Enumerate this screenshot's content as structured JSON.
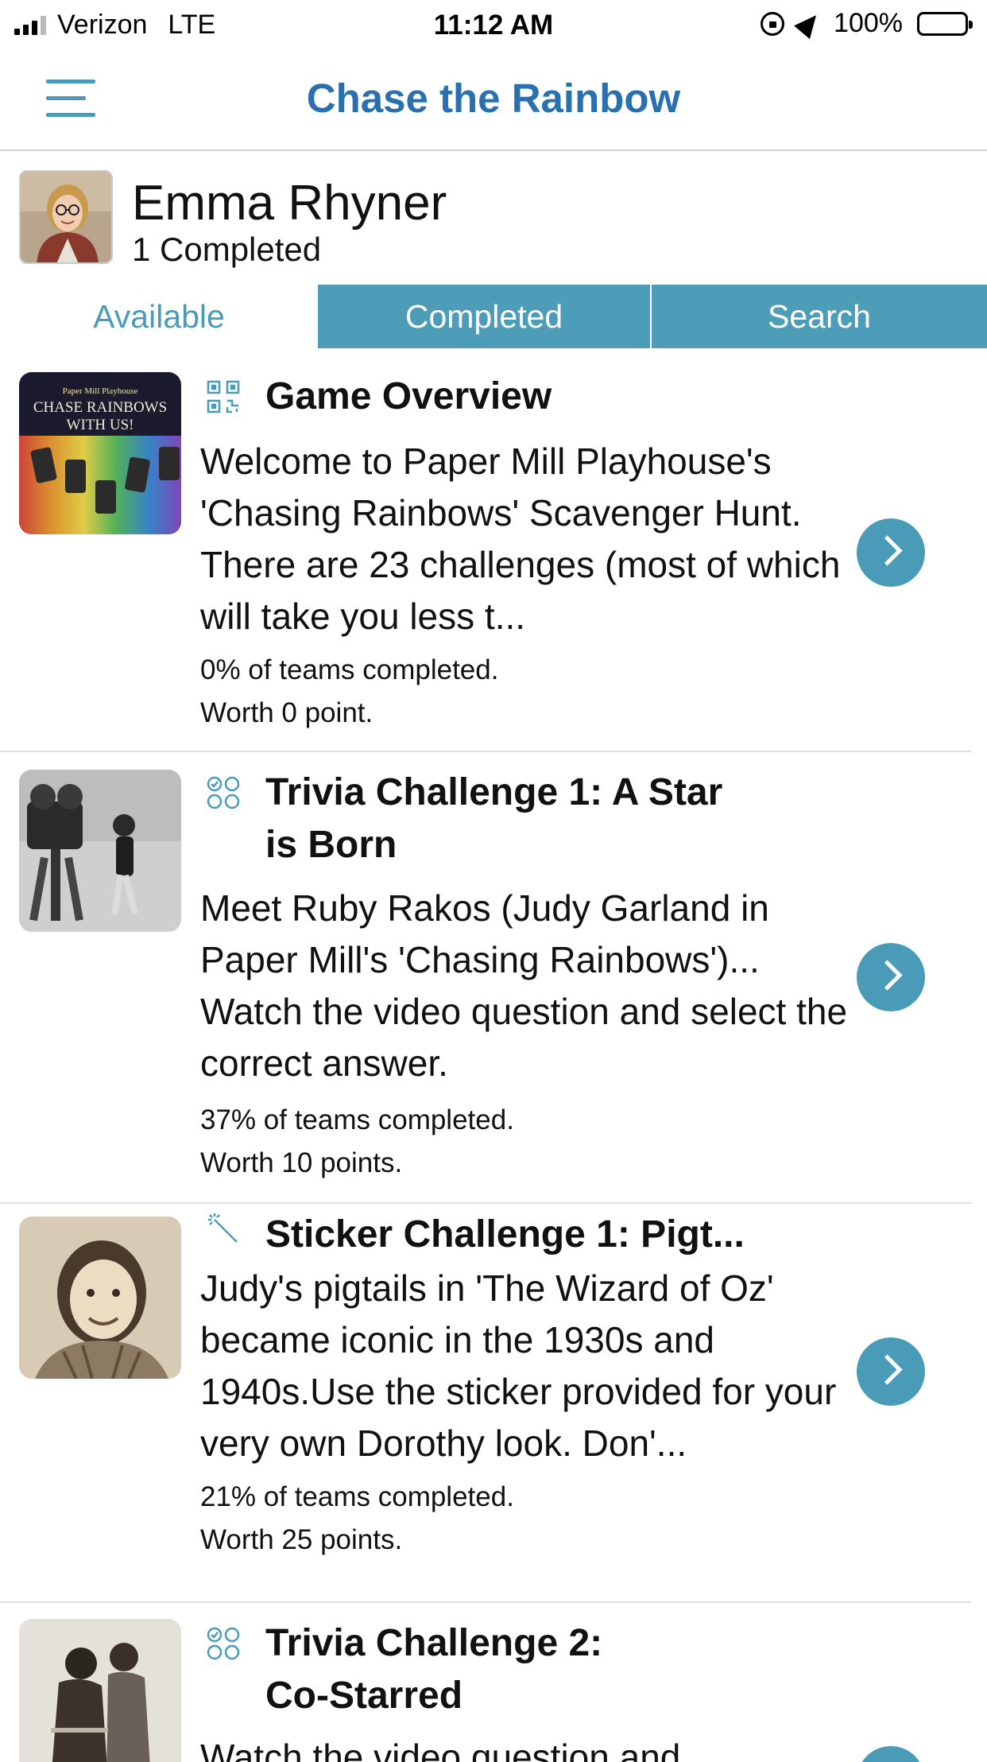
{
  "status_bar": {
    "carrier": "Verizon",
    "network": "LTE",
    "time": "11:12 AM",
    "battery": "100%"
  },
  "nav": {
    "title": "Chase the Rainbow",
    "menu_icon": "hamburger-menu-icon"
  },
  "profile": {
    "name": "Emma Rhyner",
    "completed": "1 Completed"
  },
  "tabs": [
    {
      "label": "Available",
      "selected": true
    },
    {
      "label": "Completed",
      "selected": false
    },
    {
      "label": "Search",
      "selected": false
    }
  ],
  "colors": {
    "accent": "#4a9bb8",
    "title_blue": "#2a6fae"
  },
  "items": [
    {
      "icon": "qr-code-icon",
      "title": "Game Overview",
      "description": "Welcome to Paper Mill Playhouse's 'Chasing Rainbows' Scavenger Hunt.  There are 23 challenges (most of which will take you less t...",
      "teams": "0% of teams completed.",
      "worth": "Worth 0 point.",
      "thumb_text": "CHASE RAINBOWS WITH US!",
      "thumb_small": "Paper Mill Playhouse"
    },
    {
      "icon": "multiple-choice-icon",
      "title": "Trivia Challenge 1: A Star is Born",
      "description": "Meet Ruby Rakos (Judy Garland in Paper Mill's 'Chasing Rainbows')... Watch the video question  and select the correct answer.",
      "teams": "37% of teams completed.",
      "worth": "Worth 10 points."
    },
    {
      "icon": "magic-wand-icon",
      "title": "Sticker Challenge 1: Pigt...",
      "description": "Judy's pigtails in 'The Wizard of Oz' became iconic in the 1930s and 1940s.Use the sticker provided for your very own Dorothy look. Don'...",
      "teams": "21% of teams completed.",
      "worth": "Worth 25 points."
    },
    {
      "icon": "multiple-choice-icon",
      "title": "Trivia Challenge 2: Co-Starred",
      "description": "Watch the video question and"
    }
  ]
}
